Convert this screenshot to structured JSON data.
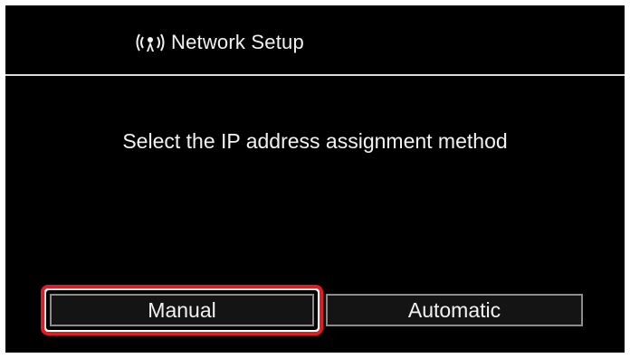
{
  "header": {
    "icon": "wireless-signal-icon",
    "title": "Network Setup"
  },
  "main": {
    "prompt": "Select the IP address assignment method"
  },
  "options": {
    "manual_label": "Manual",
    "automatic_label": "Automatic",
    "selected": "Manual"
  },
  "colors": {
    "background": "#000000",
    "text": "#f2f2f2",
    "button_fill": "#141414",
    "button_border": "#8c8c8c",
    "selection_highlight": "#e31b23"
  }
}
